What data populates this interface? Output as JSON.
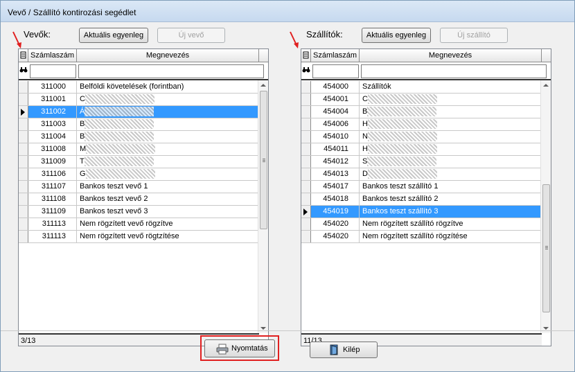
{
  "window": {
    "title": "Vevő / Szállító kontirozási segédlet"
  },
  "vevok": {
    "label": "Vevők:",
    "balance_button": "Aktuális egyenleg",
    "new_button": "Új vevő",
    "columns": [
      "Számlaszám",
      "Megnevezés"
    ],
    "rows": [
      {
        "num": "311000",
        "name": "Belföldi követelések (forintban)"
      },
      {
        "num": "311001",
        "name": "C"
      },
      {
        "num": "311002",
        "name": "Á"
      },
      {
        "num": "311003",
        "name": "B"
      },
      {
        "num": "311004",
        "name": "B"
      },
      {
        "num": "311008",
        "name": "M"
      },
      {
        "num": "311009",
        "name": "T"
      },
      {
        "num": "311106",
        "name": "G"
      },
      {
        "num": "311107",
        "name": "Bankos teszt vevő 1"
      },
      {
        "num": "311108",
        "name": "Bankos teszt vevő 2"
      },
      {
        "num": "311109",
        "name": "Bankos teszt vevő 3"
      },
      {
        "num": "311113",
        "name": "Nem rögzített vevő rögzítve"
      },
      {
        "num": "311113",
        "name": "Nem rögzített vevő rögtzítése"
      }
    ],
    "selected_index": 2,
    "status": "3/13"
  },
  "szallitok": {
    "label": "Szállítók:",
    "balance_button": "Aktuális egyenleg",
    "new_button": "Új szállító",
    "columns": [
      "Számlaszám",
      "Megnevezés"
    ],
    "rows": [
      {
        "num": "454000",
        "name": "Szállítók"
      },
      {
        "num": "454001",
        "name": "C"
      },
      {
        "num": "454004",
        "name": "B"
      },
      {
        "num": "454006",
        "name": "H"
      },
      {
        "num": "454010",
        "name": "N"
      },
      {
        "num": "454011",
        "name": "H"
      },
      {
        "num": "454012",
        "name": "S"
      },
      {
        "num": "454013",
        "name": "D"
      },
      {
        "num": "454017",
        "name": "Bankos teszt szállító 1"
      },
      {
        "num": "454018",
        "name": "Bankos teszt szállító 2"
      },
      {
        "num": "454019",
        "name": "Bankos teszt szállító 3"
      },
      {
        "num": "454020",
        "name": "Nem rögzített szállító rögzítve"
      },
      {
        "num": "454020",
        "name": "Nem rögzített szállító rögzítése"
      }
    ],
    "selected_index": 10,
    "status": "11/13"
  },
  "footer": {
    "print_button": "Nyomtatás",
    "exit_button": "Kilép"
  },
  "colors": {
    "selection": "#3399ff",
    "highlight_frame": "#e02020",
    "arrow": "#e02020"
  }
}
